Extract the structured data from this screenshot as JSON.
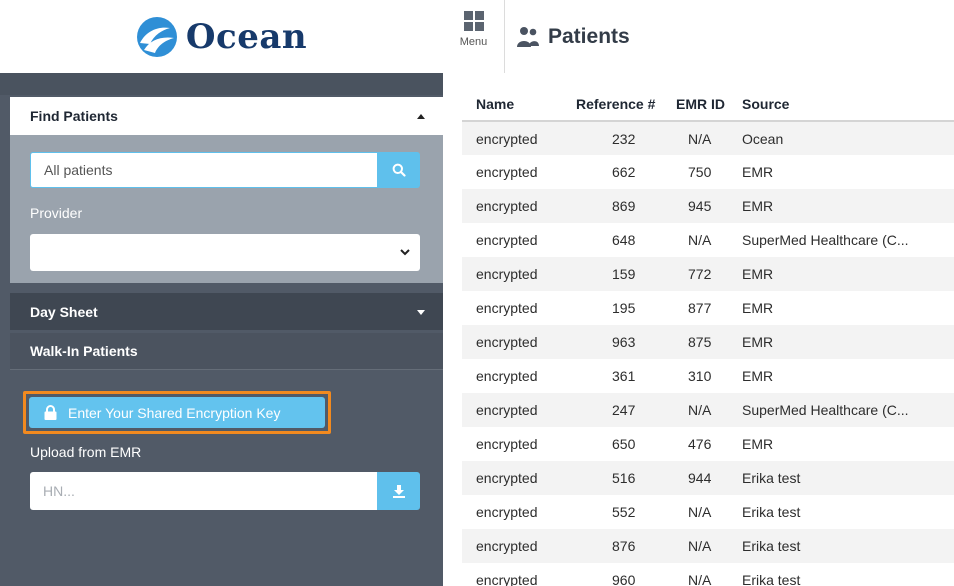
{
  "app": {
    "logo_text": "Ocean",
    "menu_label": "Menu",
    "page_title": "Patients"
  },
  "sidebar": {
    "find_patients": {
      "label": "Find Patients",
      "search_placeholder": "All patients",
      "provider_label": "Provider",
      "provider_value": ""
    },
    "day_sheet_label": "Day Sheet",
    "walk_in_label": "Walk-In Patients",
    "encryption_button_label": "Enter Your Shared Encryption Key",
    "upload_label": "Upload from EMR",
    "hn_placeholder": "HN..."
  },
  "table": {
    "headers": [
      "Name",
      "Reference #",
      "EMR ID",
      "Source"
    ],
    "rows": [
      [
        "encrypted",
        "232",
        "N/A",
        "Ocean"
      ],
      [
        "encrypted",
        "662",
        "750",
        "EMR"
      ],
      [
        "encrypted",
        "869",
        "945",
        "EMR"
      ],
      [
        "encrypted",
        "648",
        "N/A",
        "SuperMed Healthcare (C..."
      ],
      [
        "encrypted",
        "159",
        "772",
        "EMR"
      ],
      [
        "encrypted",
        "195",
        "877",
        "EMR"
      ],
      [
        "encrypted",
        "963",
        "875",
        "EMR"
      ],
      [
        "encrypted",
        "361",
        "310",
        "EMR"
      ],
      [
        "encrypted",
        "247",
        "N/A",
        "SuperMed Healthcare (C..."
      ],
      [
        "encrypted",
        "650",
        "476",
        "EMR"
      ],
      [
        "encrypted",
        "516",
        "944",
        "Erika test"
      ],
      [
        "encrypted",
        "552",
        "N/A",
        "Erika test"
      ],
      [
        "encrypted",
        "876",
        "N/A",
        "Erika test"
      ],
      [
        "encrypted",
        "960",
        "N/A",
        "Erika test"
      ]
    ]
  },
  "colors": {
    "brand_navy": "#173a6b",
    "accent_blue": "#5fc0ec",
    "highlight_orange": "#f28a1f",
    "sidebar_bg": "#515a67"
  },
  "icons": [
    "ocean-logo-icon",
    "menu-grid-icon",
    "patients-icon",
    "search-icon",
    "chevron-down-icon",
    "lock-icon",
    "download-icon"
  ]
}
